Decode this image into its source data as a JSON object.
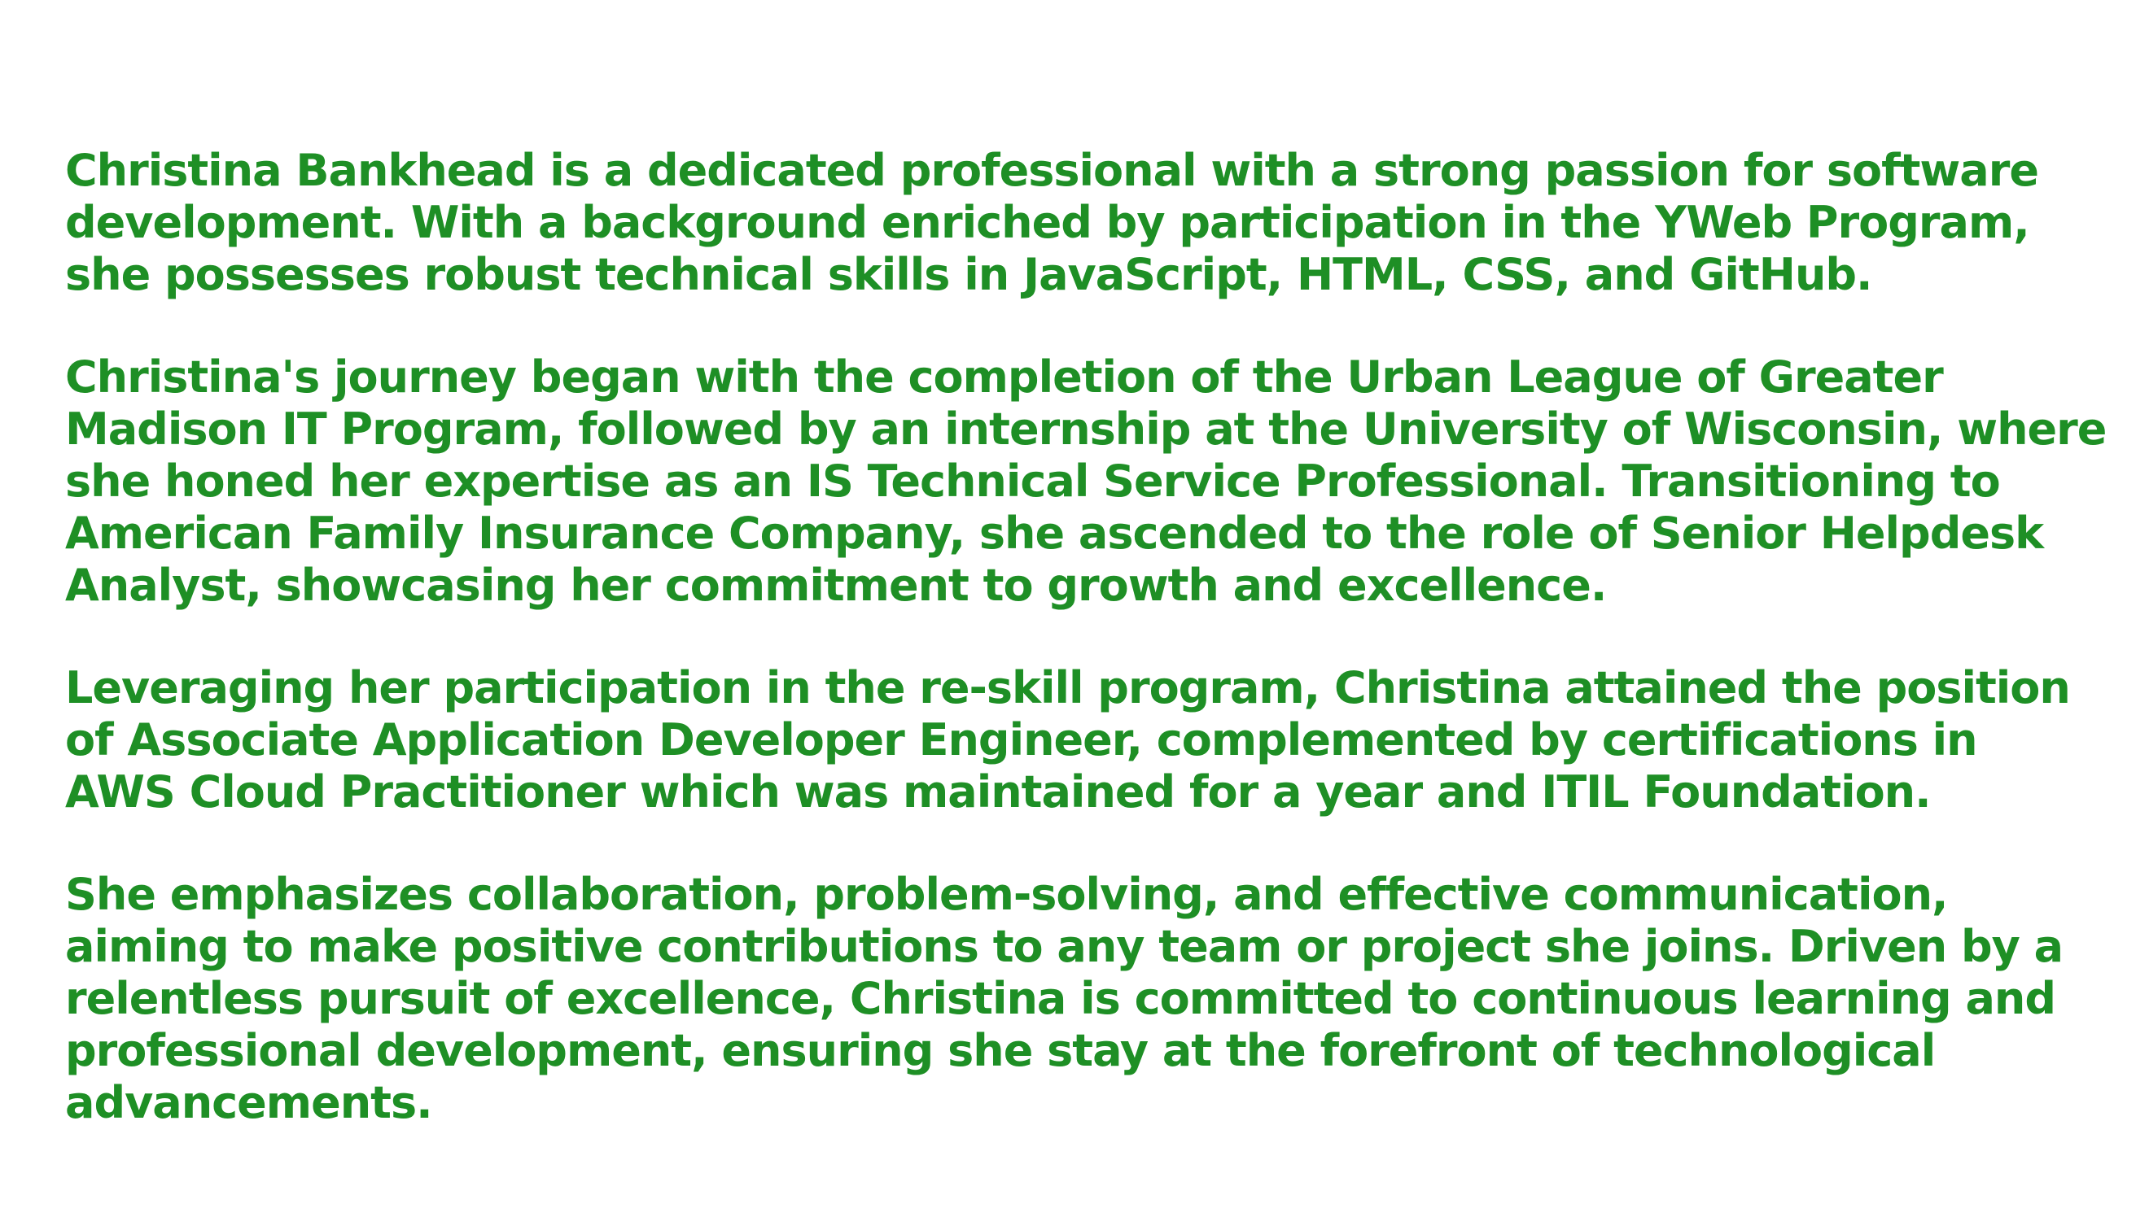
{
  "paragraphs": [
    {
      "lines": [
        "Christina Bankhead is a dedicated professional with a strong passion for software",
        "development. With a background enriched by participation in the YWeb Program,",
        "she possesses robust technical skills in JavaScript, HTML, CSS, and GitHub."
      ]
    },
    {
      "lines": [
        "Christina's journey began with the completion of the Urban League of Greater",
        "Madison IT Program, followed by an internship at the University of Wisconsin, where",
        "she honed her expertise as an IS Technical Service Professional. Transitioning to",
        "American Family Insurance Company, she ascended to the role of Senior Helpdesk",
        "Analyst, showcasing her commitment to growth and excellence."
      ]
    },
    {
      "lines": [
        "Leveraging her participation in the re-skill program, Christina attained the position",
        "of Associate Application Developer Engineer, complemented by certifications in",
        "AWS Cloud Practitioner which was maintained for a year and ITIL Foundation."
      ]
    },
    {
      "lines": [
        "She emphasizes collaboration, problem-solving, and effective communication,",
        "aiming to make positive contributions to any team or project she joins. Driven by a",
        "relentless pursuit of excellence, Christina is committed to continuous learning and",
        "professional development, ensuring she stay at the forefront of technological",
        "advancements."
      ]
    }
  ],
  "colors": {
    "text": "#1e8f25",
    "background": "#ffffff"
  }
}
